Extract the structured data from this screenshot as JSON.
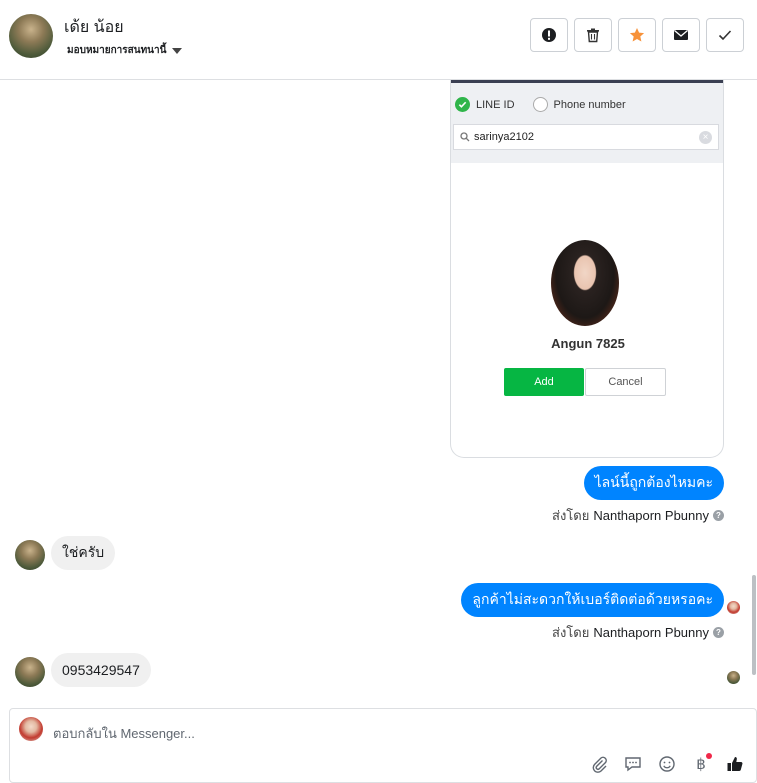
{
  "header": {
    "name": "เด้ย น้อย",
    "subtitle": "มอบหมายการสนทนานี้",
    "buttons": [
      "mark-spam",
      "delete",
      "star",
      "mark-unread",
      "done"
    ]
  },
  "line_card": {
    "option_line_id": "LINE ID",
    "option_phone": "Phone number",
    "search_value": "sarinya2102",
    "profile_name": "Angun 7825",
    "add_label": "Add",
    "cancel_label": "Cancel"
  },
  "messages": [
    {
      "dir": "out",
      "text": "ไลน์นี้ถูกต้องไหมคะ"
    },
    {
      "dir": "in",
      "text": "ใช่ครับ"
    },
    {
      "dir": "out",
      "text": "ลูกค้าไม่สะดวกให้เบอร์ติดต่อด้วยหรอคะ"
    },
    {
      "dir": "in",
      "text": "0953429547"
    }
  ],
  "sent_by": {
    "prefix": "ส่งโดย",
    "name": "Nanthaporn Pbunny"
  },
  "composer": {
    "placeholder": "ตอบกลับใน Messenger...",
    "currency": "฿"
  },
  "colors": {
    "accent": "#0084ff",
    "line_green": "#06b643",
    "star": "#f7923a"
  }
}
